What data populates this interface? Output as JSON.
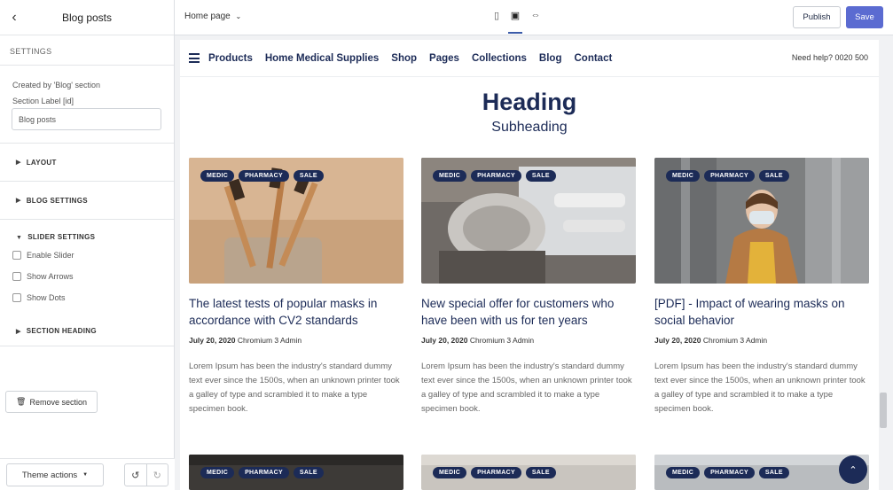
{
  "sidebar": {
    "title": "Blog posts",
    "settings_label": "SETTINGS",
    "created_by": "Created by 'Blog' section",
    "section_label": "Section Label [id]",
    "section_label_value": "Blog posts",
    "accordions": {
      "layout": "LAYOUT",
      "blog_settings": "BLOG SETTINGS",
      "slider_settings": "SLIDER SETTINGS",
      "section_heading": "SECTION HEADING"
    },
    "checkboxes": {
      "enable_slider": "Enable Slider",
      "show_arrows": "Show Arrows",
      "show_dots": "Show Dots"
    },
    "remove_section": "Remove section",
    "theme_actions": "Theme actions"
  },
  "topbar": {
    "page_select": "Home page",
    "publish": "Publish",
    "save": "Save"
  },
  "site": {
    "nav": [
      "Products",
      "Home Medical Supplies",
      "Shop",
      "Pages",
      "Collections",
      "Blog",
      "Contact"
    ],
    "help": "Need help? 0020 500",
    "heading": "Heading",
    "subheading": "Subheading",
    "tags": [
      "MEDIC",
      "PHARMACY",
      "SALE"
    ],
    "posts": [
      {
        "title": "The latest tests of popular masks in accordance with CV2 standards",
        "date": "July 20, 2020",
        "author": "Chromium 3 Admin",
        "excerpt": "Lorem Ipsum has been the industry's standard dummy text ever since the 1500s, when an unknown printer took a galley of type and scrambled it to make a type specimen book."
      },
      {
        "title": "New special offer for customers who have been with us for ten years",
        "date": "July 20, 2020",
        "author": "Chromium 3 Admin",
        "excerpt": "Lorem Ipsum has been the industry's standard dummy text ever since the 1500s, when an unknown printer took a galley of type and scrambled it to make a type specimen book."
      },
      {
        "title": "[PDF] - Impact of wearing masks on social behavior",
        "date": "July 20, 2020",
        "author": "Chromium 3 Admin",
        "excerpt": "Lorem Ipsum has been the industry's standard dummy text ever since the 1500s, when an unknown printer took a galley of type and scrambled it to make a type specimen book."
      }
    ]
  },
  "colors": {
    "brand_navy": "#1c2b57",
    "save_button": "#5b6bd1"
  }
}
